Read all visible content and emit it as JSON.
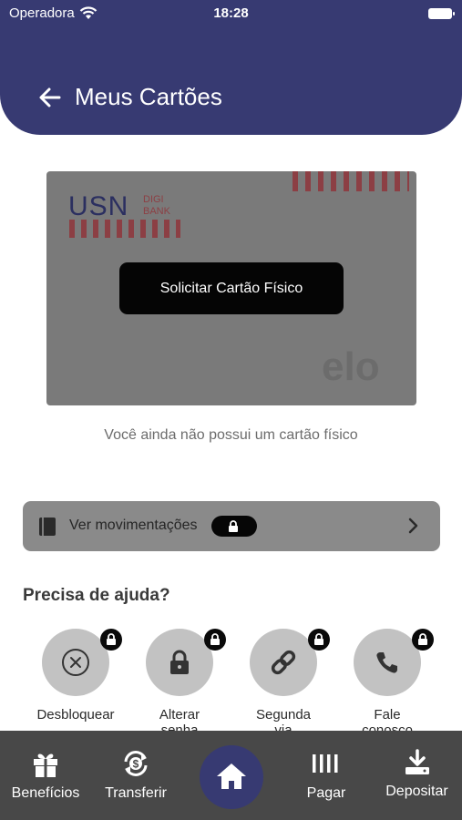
{
  "status_bar": {
    "carrier": "Operadora",
    "time": "18:28"
  },
  "header": {
    "title": "Meus Cartões"
  },
  "card": {
    "brand_logo": "USN",
    "brand_sub_1": "DIGI",
    "brand_sub_2": "BANK",
    "network_logo": "elo",
    "request_button": "Solicitar Cartão Físico"
  },
  "no_card_message": "Você ainda não possui um cartão físico",
  "movements": {
    "label": "Ver movimentações"
  },
  "help": {
    "title": "Precisa de ajuda?",
    "items": [
      {
        "label_1": "Desbloquear",
        "label_2": "",
        "icon": "close-circle-icon"
      },
      {
        "label_1": "Alterar",
        "label_2": "senha",
        "icon": "lock-icon"
      },
      {
        "label_1": "Segunda",
        "label_2": "via",
        "icon": "link-icon"
      },
      {
        "label_1": "Fale",
        "label_2": "conosco",
        "icon": "phone-icon"
      }
    ]
  },
  "bottom_nav": {
    "items": [
      {
        "label": "Benefícios",
        "icon": "gift-icon"
      },
      {
        "label": "Transferir",
        "icon": "transfer-icon"
      },
      {
        "label": "",
        "icon": "home-icon"
      },
      {
        "label": "Pagar",
        "icon": "barcode-icon"
      },
      {
        "label": "Depositar",
        "icon": "download-icon"
      }
    ]
  },
  "colors": {
    "primary": "#373a72",
    "card": "#7a7a7a",
    "accent_stripes": "#8c3f44",
    "nav_bg": "#484848"
  }
}
